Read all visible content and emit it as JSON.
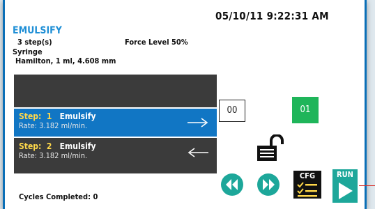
{
  "header": {
    "datetime": "05/10/11 9:22:31 AM"
  },
  "method": {
    "title": "EMULSIFY",
    "steps_count": "3 step(s)",
    "force_level": "Force Level 50%",
    "syringe_label": "Syringe",
    "syringe_value": "Hamilton, 1 ml, 4.608 mm"
  },
  "steps": [
    {
      "number_label": "Step:  1",
      "name": "Emulsify",
      "rate": "Rate: 3.182 ml/min.",
      "direction": "right-arrow",
      "selected": true
    },
    {
      "number_label": "Step:  2",
      "name": "Emulsify",
      "rate": "Rate: 3.182 ml/min.",
      "direction": "left-arrow",
      "selected": false
    }
  ],
  "counters": {
    "left": "00",
    "right": "01"
  },
  "controls": {
    "lock_icon": "lock-open-icon",
    "rewind_icon": "rewind-icon",
    "ffwd_icon": "fast-forward-icon",
    "cfg_label": "CFG",
    "cfg_icon": "checklist-icon",
    "run_label": "RUN",
    "run_icon": "play-icon"
  },
  "footer": {
    "cycles": "Cycles Completed: 0"
  },
  "colors": {
    "accent_blue": "#1176c4",
    "title_blue": "#1f8fd6",
    "step_yellow": "#ffd84a",
    "green": "#1fb55a",
    "run_teal": "#1da79a",
    "panel_dark": "#3b3b3b"
  }
}
